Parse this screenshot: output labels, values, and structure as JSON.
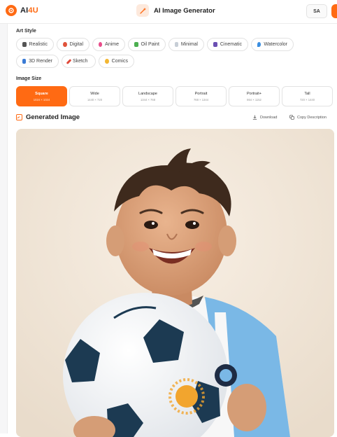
{
  "header": {
    "brand": {
      "prefix": "AI",
      "suffix": "4U"
    },
    "title": "AI Image Generator",
    "avatar_initials": "SA"
  },
  "art_style": {
    "label": "Art Style",
    "options": [
      {
        "label": "Realistic",
        "icon": "camera-icon",
        "color": "#555555"
      },
      {
        "label": "Digital",
        "icon": "palette-icon",
        "color": "#e0533b"
      },
      {
        "label": "Anime",
        "icon": "sparkle-icon",
        "color": "#e84d8a"
      },
      {
        "label": "Oil Paint",
        "icon": "canvas-icon",
        "color": "#4caf50"
      },
      {
        "label": "Minimal",
        "icon": "square-icon",
        "color": "#9aa6b2"
      },
      {
        "label": "Cinematic",
        "icon": "film-icon",
        "color": "#6b4fb3"
      },
      {
        "label": "Watercolor",
        "icon": "droplet-icon",
        "color": "#3b8ee0"
      },
      {
        "label": "3D Render",
        "icon": "cube-icon",
        "color": "#3a7bd5"
      },
      {
        "label": "Sketch",
        "icon": "pencil-icon",
        "color": "#e04b3b"
      },
      {
        "label": "Comics",
        "icon": "comic-icon",
        "color": "#f2b632"
      }
    ]
  },
  "image_size": {
    "label": "Image Size",
    "selected": "Square",
    "options": [
      {
        "label": "Square",
        "dims": "1024 × 1024"
      },
      {
        "label": "Wide",
        "dims": "1440 × 720"
      },
      {
        "label": "Landscape",
        "dims": "1344 × 768"
      },
      {
        "label": "Portrait",
        "dims": "768 × 1344"
      },
      {
        "label": "Portrait+",
        "dims": "864 × 1152"
      },
      {
        "label": "Tall",
        "dims": "720 × 1440"
      }
    ]
  },
  "generated": {
    "title": "Generated Image",
    "download_label": "Download",
    "copy_label": "Copy Description"
  },
  "colors": {
    "accent": "#ff6a13",
    "jersey_blue": "#7ab8e6"
  }
}
